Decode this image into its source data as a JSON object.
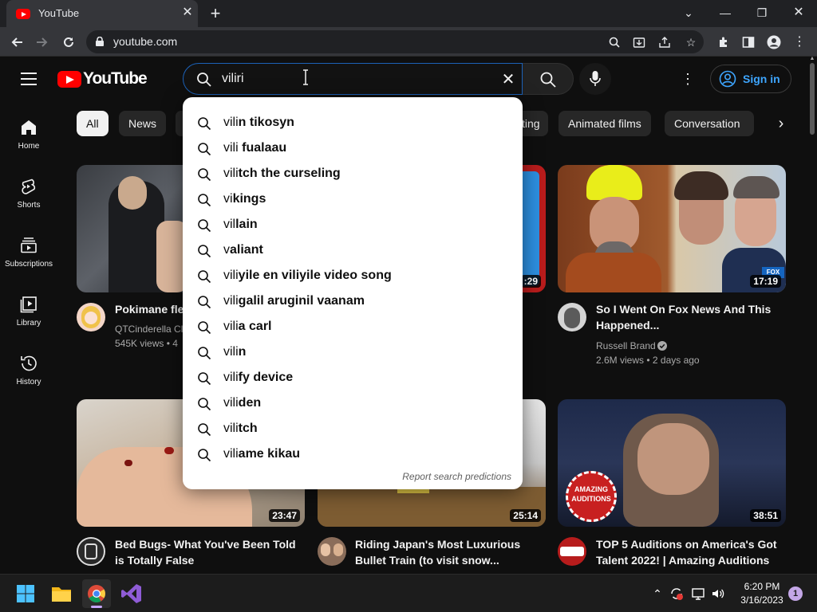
{
  "browser": {
    "tab_title": "YouTube",
    "url": "youtube.com"
  },
  "header": {
    "logo_text": "YouTube",
    "search_value": "viliri",
    "signin_label": "Sign in"
  },
  "sidebar": {
    "items": [
      {
        "label": "Home",
        "icon": "home-icon"
      },
      {
        "label": "Shorts",
        "icon": "shorts-icon"
      },
      {
        "label": "Subscriptions",
        "icon": "subscriptions-icon"
      },
      {
        "label": "Library",
        "icon": "library-icon"
      },
      {
        "label": "History",
        "icon": "history-icon"
      }
    ]
  },
  "chips": [
    "All",
    "News",
    "ting",
    "Animated films",
    "Conversation"
  ],
  "suggestions": {
    "items": [
      {
        "typed": "vili",
        "rest": "n tikosyn"
      },
      {
        "typed": "vili",
        "rest": " fualaau"
      },
      {
        "typed": "vili",
        "rest": "tch the curseling"
      },
      {
        "typed": "vi",
        "rest": "kings"
      },
      {
        "typed": "vil",
        "rest": "lain"
      },
      {
        "typed": "v",
        "rest": "aliant"
      },
      {
        "typed": "vili",
        "rest": "yile en viliyile video song"
      },
      {
        "typed": "vili",
        "rest": "galil aruginil vaanam"
      },
      {
        "typed": "vili",
        "rest": "a carl"
      },
      {
        "typed": "vili",
        "rest": "n"
      },
      {
        "typed": "vili",
        "rest": "fy device"
      },
      {
        "typed": "vili",
        "rest": "den"
      },
      {
        "typed": "vili",
        "rest": "tch"
      },
      {
        "typed": "vili",
        "rest": "ame kikau"
      }
    ],
    "report_label": "Report search predictions"
  },
  "videos": [
    {
      "title_line1": "Pokimane flex",
      "title_line2": "",
      "channel": "QTCinderella Cli",
      "stats": "545K views • 4",
      "duration": ""
    },
    {
      "title_line1": "",
      "title_line2": "",
      "channel": "",
      "stats": "",
      "duration": ":29"
    },
    {
      "title_line1": "So I Went On Fox News And This",
      "title_line2": "Happened...",
      "channel": "Russell Brand",
      "stats": "2.6M views • 2 days ago",
      "duration": "17:19",
      "verified": true
    },
    {
      "title_line1": "Bed Bugs- What You've Been Told",
      "title_line2": "is Totally False",
      "channel": "",
      "stats": "",
      "duration": "23:47"
    },
    {
      "title_line1": "Riding Japan's Most Luxurious",
      "title_line2": "Bullet Train (to visit snow...",
      "channel": "",
      "stats": "",
      "duration": "25:14"
    },
    {
      "title_line1": "TOP 5 Auditions on America's Got",
      "title_line2": "Talent 2022! | Amazing Auditions",
      "channel": "",
      "stats": "",
      "duration": "38:51"
    }
  ],
  "thumbnail_badges": {
    "fox_logo": "FOX",
    "amazing_auditions": "AMAZING AUDITIONS"
  },
  "taskbar": {
    "time": "6:20 PM",
    "date": "3/16/2023",
    "notification_count": "1"
  },
  "colors": {
    "youtube_red": "#ff0000",
    "link_blue": "#3ea6ff",
    "search_focus": "#1c62b9"
  }
}
